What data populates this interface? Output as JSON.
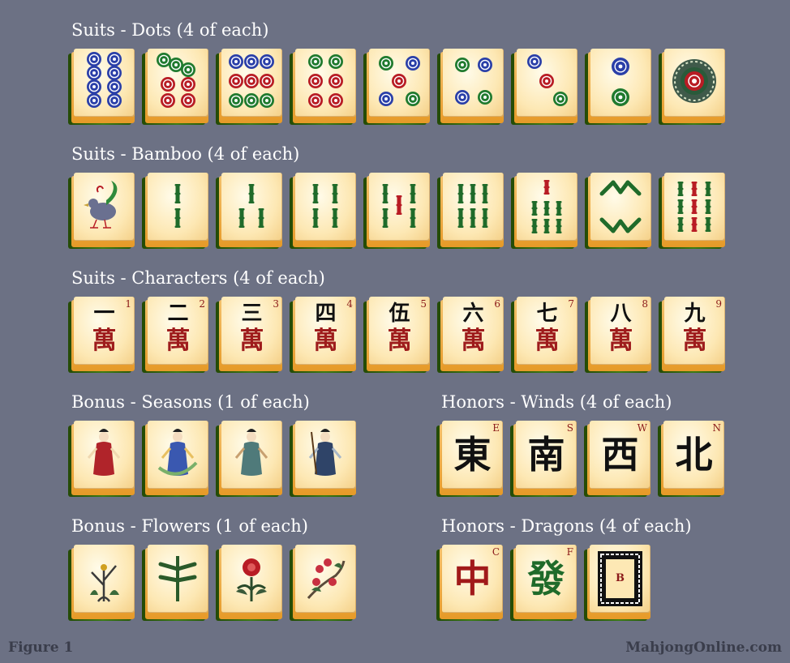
{
  "sections": {
    "dots": {
      "heading": "Suits - Dots (4 of each)"
    },
    "bamboo": {
      "heading": "Suits - Bamboo (4 of each)"
    },
    "characters": {
      "heading": "Suits - Characters (4 of each)",
      "tiles": [
        {
          "top": "一",
          "bottom": "萬",
          "num": "1"
        },
        {
          "top": "二",
          "bottom": "萬",
          "num": "2"
        },
        {
          "top": "三",
          "bottom": "萬",
          "num": "3"
        },
        {
          "top": "四",
          "bottom": "萬",
          "num": "4"
        },
        {
          "top": "伍",
          "bottom": "萬",
          "num": "5"
        },
        {
          "top": "六",
          "bottom": "萬",
          "num": "6"
        },
        {
          "top": "七",
          "bottom": "萬",
          "num": "7"
        },
        {
          "top": "八",
          "bottom": "萬",
          "num": "8"
        },
        {
          "top": "九",
          "bottom": "萬",
          "num": "9"
        }
      ]
    },
    "seasons": {
      "heading": "Bonus - Seasons (1 of each)"
    },
    "winds": {
      "heading": "Honors - Winds (4 of each)",
      "tiles": [
        {
          "glyph": "東",
          "num": "E"
        },
        {
          "glyph": "南",
          "num": "S"
        },
        {
          "glyph": "西",
          "num": "W"
        },
        {
          "glyph": "北",
          "num": "N"
        }
      ]
    },
    "flowers": {
      "heading": "Bonus - Flowers (1 of each)"
    },
    "dragons": {
      "heading": "Honors - Dragons (4 of each)",
      "tiles": [
        {
          "glyph": "中",
          "num": "C",
          "color": "#a11a1a"
        },
        {
          "glyph": "發",
          "num": "F",
          "color": "#1f6b2a"
        },
        {
          "glyph": "",
          "num": "B",
          "color": "#8b1a1a"
        }
      ]
    }
  },
  "colors": {
    "background": "#6c7184",
    "dot_blue": "#2a3fa8",
    "dot_green": "#1f7a2e",
    "dot_red": "#b81c24",
    "bamboo_green": "#1f6b2a"
  },
  "footer": {
    "left": "Figure 1",
    "right": "MahjongOnline.com"
  }
}
